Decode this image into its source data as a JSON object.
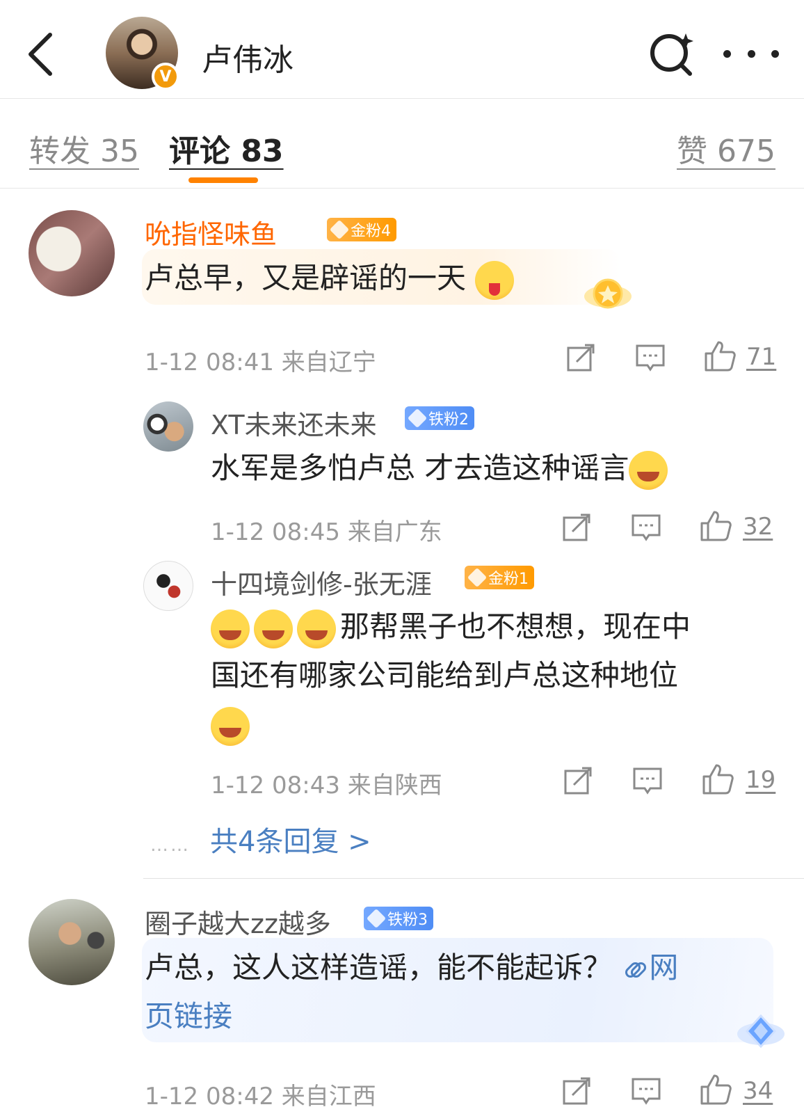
{
  "header": {
    "title": "卢伟冰",
    "verified_badge": "V"
  },
  "tabs": {
    "repost": "转发 35",
    "comments": "评论 83",
    "likes": "赞 675"
  },
  "comments": [
    {
      "name": "吮指怪味鱼",
      "badge": "金粉4",
      "text": "卢总早，又是辟谣的一天",
      "meta": "1-12 08:41  来自辽宁",
      "likes": "71",
      "replies": [
        {
          "name": "XT未来还未来",
          "badge": "铁粉2",
          "text": "水军是多怕卢总 才去造这种谣言",
          "meta": "1-12 08:45  来自广东",
          "likes": "32"
        },
        {
          "name": "十四境剑修-张无涯",
          "badge": "金粉1",
          "text_line1": "那帮黑子也不想想，现在中",
          "text_line2": "国还有哪家公司能给到卢总这种地位",
          "meta": "1-12 08:43  来自陕西",
          "likes": "19"
        }
      ],
      "reply_dots": "……",
      "more_replies": "共4条回复 >"
    },
    {
      "name": "圈子越大zz越多",
      "badge": "铁粉3",
      "text": "卢总，这人这样造谣，能不能起诉？",
      "link_text_a": "网",
      "link_text_b": "页链接",
      "meta": "1-12 08:42  来自江西",
      "likes": "34"
    }
  ],
  "colors": {
    "accent": "#ff8200",
    "link": "#4a7fc1",
    "gold_name": "#ff6600"
  }
}
